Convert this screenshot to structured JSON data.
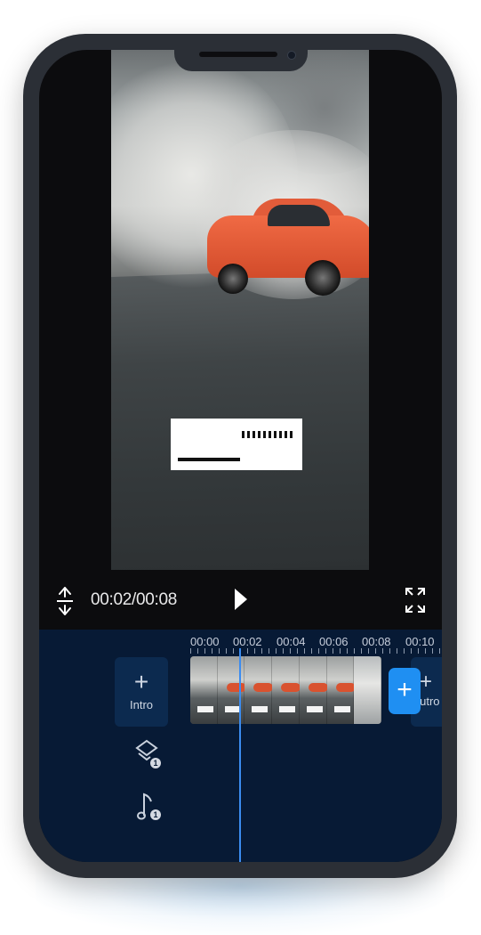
{
  "player": {
    "time_display": "00:02/00:08",
    "play_icon": "play-icon",
    "expand_vertical_icon": "vertical-resize-icon",
    "fullscreen_icon": "fullscreen-icon"
  },
  "timeline": {
    "ticks": [
      "00:00",
      "00:02",
      "00:04",
      "00:06",
      "00:08",
      "00:10"
    ],
    "intro_label": "Intro",
    "outro_label": "Outro",
    "add_clip_symbol": "+",
    "plus_symbol": "+",
    "layer_badge": "1",
    "music_badge": "1"
  },
  "colors": {
    "accent": "#1f8ff2",
    "timeline_bg": "#071a35",
    "phone_frame": "#2b2f36"
  }
}
